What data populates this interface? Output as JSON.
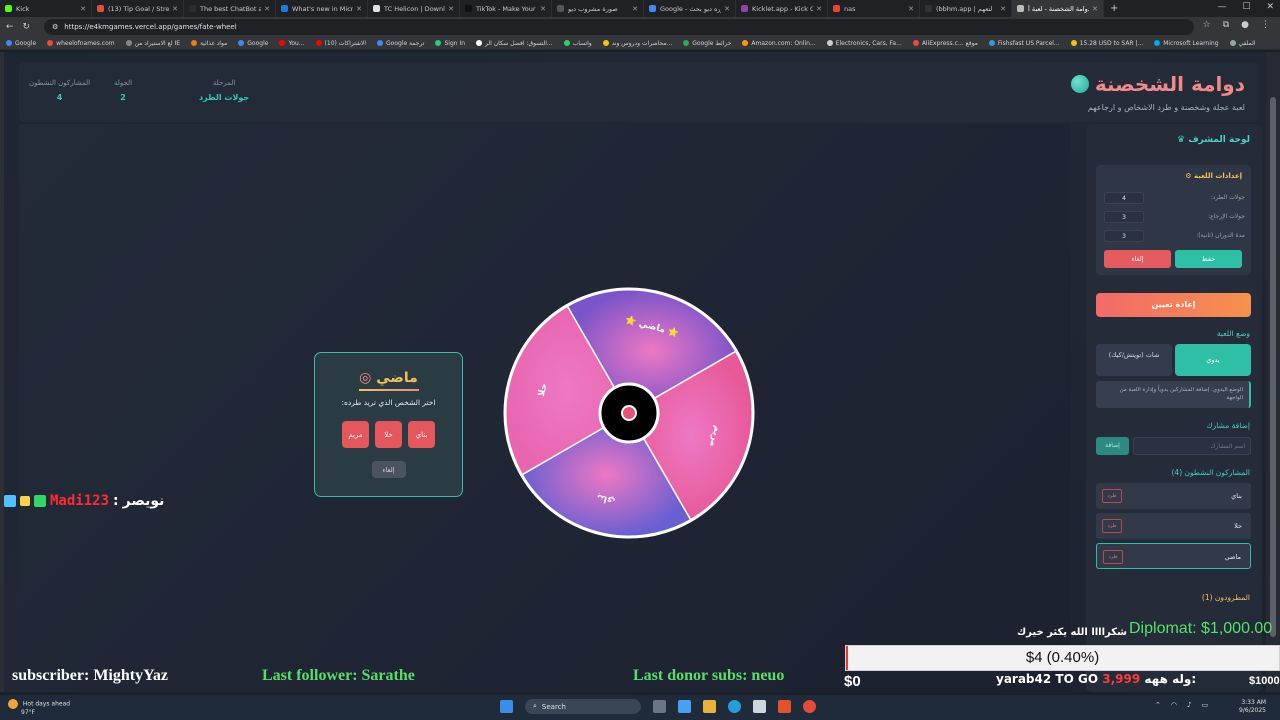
{
  "browser": {
    "tabs": [
      {
        "title": "Kick",
        "color": "#53fc18"
      },
      {
        "title": "(13) Tip Goal / Streamlab",
        "color": "#e74c3c"
      },
      {
        "title": "The best ChatBot and W",
        "color": "#2c2c2c"
      },
      {
        "title": "What's new in Microsoft",
        "color": "#1f7ae0"
      },
      {
        "title": "TC Helicon | Downloads",
        "color": "#e0e0e0"
      },
      {
        "title": "TikTok - Make Your Day",
        "color": "#111111"
      },
      {
        "title": "صورة مشروب ديو",
        "color": "#555555"
      },
      {
        "title": "Google - صوره ديو بحث",
        "color": "#4285f4"
      },
      {
        "title": "Kicklet.app - Kick Chatb",
        "color": "#8e44ad"
      },
      {
        "title": "nas",
        "color": "#ea4335"
      },
      {
        "title": "(bbhm.app | لتعهم",
        "color": "#333333"
      },
      {
        "title": "دوامة الشخصنة - لعبة أ",
        "color": "#bbbbbb"
      }
    ],
    "url": "https://e4kmgames.vercel.app/games/fate-wheel",
    "bookmarks": [
      "Google",
      "wheelofnames.com",
      "لع الاستيراد من IE",
      "مواد غذائية",
      "Google",
      "You...",
      "(10) الاشتراكات",
      "Google ترجمة",
      "Sign In",
      "التسوق: افضل سكان الر...",
      "واتساب",
      "محاضرات ودروس وند...",
      "Google خرائط",
      "Amazon.com: Onlin...",
      "Electronics, Cars, Fa...",
      "AliExpress.c... موقع",
      "Fishsfast US Parcel...",
      "15.28 USD to SAR |...",
      "Microsoft Learning",
      "الملفي"
    ]
  },
  "app": {
    "title": "دوامة الشخصنة",
    "subtitle": "لعبة عجلة وشخصنة و طرد الاشخاص و ارجاعهم",
    "stats": [
      {
        "label": "المرحلة",
        "value": "جولات الطرد"
      },
      {
        "label": "الجولة",
        "value": "2"
      },
      {
        "label": "المشاركون النشطون",
        "value": "4"
      }
    ],
    "wheel": {
      "segments": [
        {
          "label": "⭐ ماضي ⭐",
          "color": "#7b54c9"
        },
        {
          "label": "مريم",
          "color": "#e75a9a"
        },
        {
          "label": "بناي",
          "color": "#6a5fd1"
        },
        {
          "label": "حلا",
          "color": "#e866b0"
        }
      ],
      "center_icon": "target-icon"
    },
    "popup": {
      "name": "ماضي",
      "question": "اختر الشخص الذي تريد طرده:",
      "options": [
        "بناي",
        "حلا",
        "مريم"
      ],
      "cancel": "إلغاء"
    },
    "admin": {
      "title": "لوحة المشرف",
      "settings_title": "إعدادات اللعبة",
      "settings": [
        {
          "label": "جولات الطرد:",
          "value": "4"
        },
        {
          "label": "جولات الإرجاع:",
          "value": "3"
        },
        {
          "label": "مدة الدوران (ثانية):",
          "value": "3"
        }
      ],
      "save": "حفظ",
      "cancel": "إلغاء",
      "reset": "إعادة تعيين",
      "mode_title": "وضع اللعبة",
      "mode_auto": "يدوي",
      "mode_chat": "شات (تويتش/كيك)",
      "mode_note": "الوضع اليدوي: إضافة المشاركين يدوياً وإدارة اللعبة من الواجهة",
      "add_title": "إضافة مشارك",
      "add_placeholder": "اسم المشارك",
      "add_button": "إضافة",
      "active_title": "المشاركون النشطون (4)",
      "participants": [
        {
          "name": "بناي",
          "remove": "طرد"
        },
        {
          "name": "حلا",
          "remove": "طرد"
        },
        {
          "name": "ماضي",
          "remove": "طرد"
        }
      ],
      "kicked_title": "المطرودون (1)"
    }
  },
  "overlay": {
    "chat_user": "Madi123",
    "chat_sep": ":",
    "chat_msg": "نويصر",
    "subscriber": "subscriber: MightyYaz",
    "follower": "Last follower: Sarathe",
    "donor": "Last donor subs: neuo",
    "thanks": "شكراااا الله يكثر خيرك",
    "diplomat": "Diplomat: $1,000.00",
    "goal_text": "$4 (0.40%)",
    "goal_progress": 0.004,
    "goal_min": "$0",
    "goal_max": "$1000",
    "ticker_name": "yarab42",
    "ticker_goal": "TO GO",
    "ticker_amount": "3,999",
    "ticker_msg": "وله ههه:"
  },
  "taskbar": {
    "weather_title": "Hot days ahead",
    "weather_temp": "97°F",
    "search": "Search",
    "time": "3:33 AM",
    "date": "9/6/2025"
  }
}
